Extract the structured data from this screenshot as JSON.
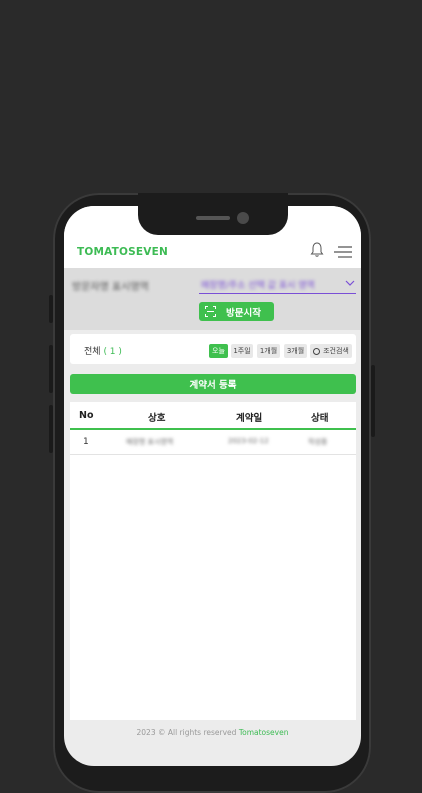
{
  "app": {
    "brand": "TOMATOSEVEN"
  },
  "visit": {
    "visitor_name": "방문자명 표시영역",
    "store_value": "매장명/주소 선택 값 표시 영역",
    "start_button": "방문시작"
  },
  "filter": {
    "total_label": "전체",
    "total_count": "( 1 )",
    "chips": [
      "오늘",
      "1주일",
      "1개월",
      "3개월"
    ],
    "active_chip": "오늘",
    "search_chip": "조건검색"
  },
  "actions": {
    "register_button": "계약서 등록"
  },
  "table": {
    "headers": [
      "No",
      "상호",
      "계약일",
      "상태"
    ],
    "rows": [
      {
        "no": "1",
        "name": "매장명 표시영역",
        "date": "2023-02-12",
        "status": "작성중"
      }
    ]
  },
  "footer": {
    "copyright": "2023 © All rights reserved",
    "brand": "Tomatoseven"
  },
  "colors": {
    "accent": "#3fc04e",
    "select_underline": "#7a4fd6",
    "background": "#2a2a2a"
  }
}
